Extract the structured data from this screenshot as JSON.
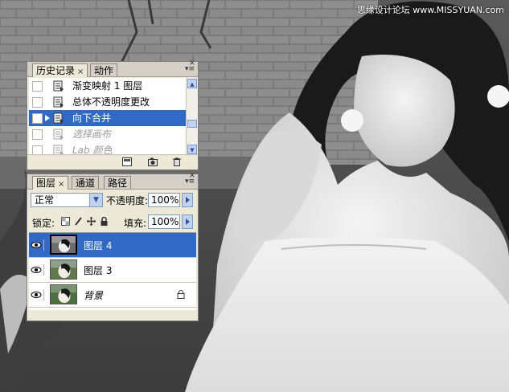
{
  "watermark": "思缘设计论坛 www.MISSYUAN.com",
  "history_panel": {
    "tabs": [
      {
        "label": "历史记录",
        "active": true,
        "closable": true
      },
      {
        "label": "动作",
        "active": false,
        "closable": false
      }
    ],
    "close_glyph": "×",
    "menu_glyph": "▾≡",
    "items": [
      {
        "label": "渐变映射 1 图层",
        "state": "normal"
      },
      {
        "label": "总体不透明度更改",
        "state": "normal"
      },
      {
        "label": "向下合并",
        "state": "selected"
      },
      {
        "label": "选择画布",
        "state": "dimmed"
      },
      {
        "label": "Lab 颜色",
        "state": "dimmed"
      }
    ],
    "footer_icons": [
      "new-document-from-state-icon",
      "new-snapshot-icon",
      "trash-icon"
    ]
  },
  "layers_panel": {
    "tabs": [
      {
        "label": "图层",
        "active": true,
        "closable": true
      },
      {
        "label": "通道",
        "active": false,
        "closable": false
      },
      {
        "label": "路径",
        "active": false,
        "closable": false
      }
    ],
    "close_glyph": "×",
    "blend_mode": "正常",
    "opacity_label": "不透明度:",
    "opacity_value": "100%",
    "lock_label": "锁定:",
    "fill_label": "填充:",
    "fill_value": "100%",
    "layers": [
      {
        "name": "图层 4",
        "selected": true,
        "visible": true,
        "locked": false,
        "italic": false
      },
      {
        "name": "图层 3",
        "selected": false,
        "visible": true,
        "locked": false,
        "italic": false
      },
      {
        "name": "背景",
        "selected": false,
        "visible": true,
        "locked": true,
        "italic": true
      }
    ]
  },
  "colors": {
    "selection": "#316ac5",
    "panel_bg": "#ece9d8",
    "tab_bg": "#d4d0c8"
  }
}
